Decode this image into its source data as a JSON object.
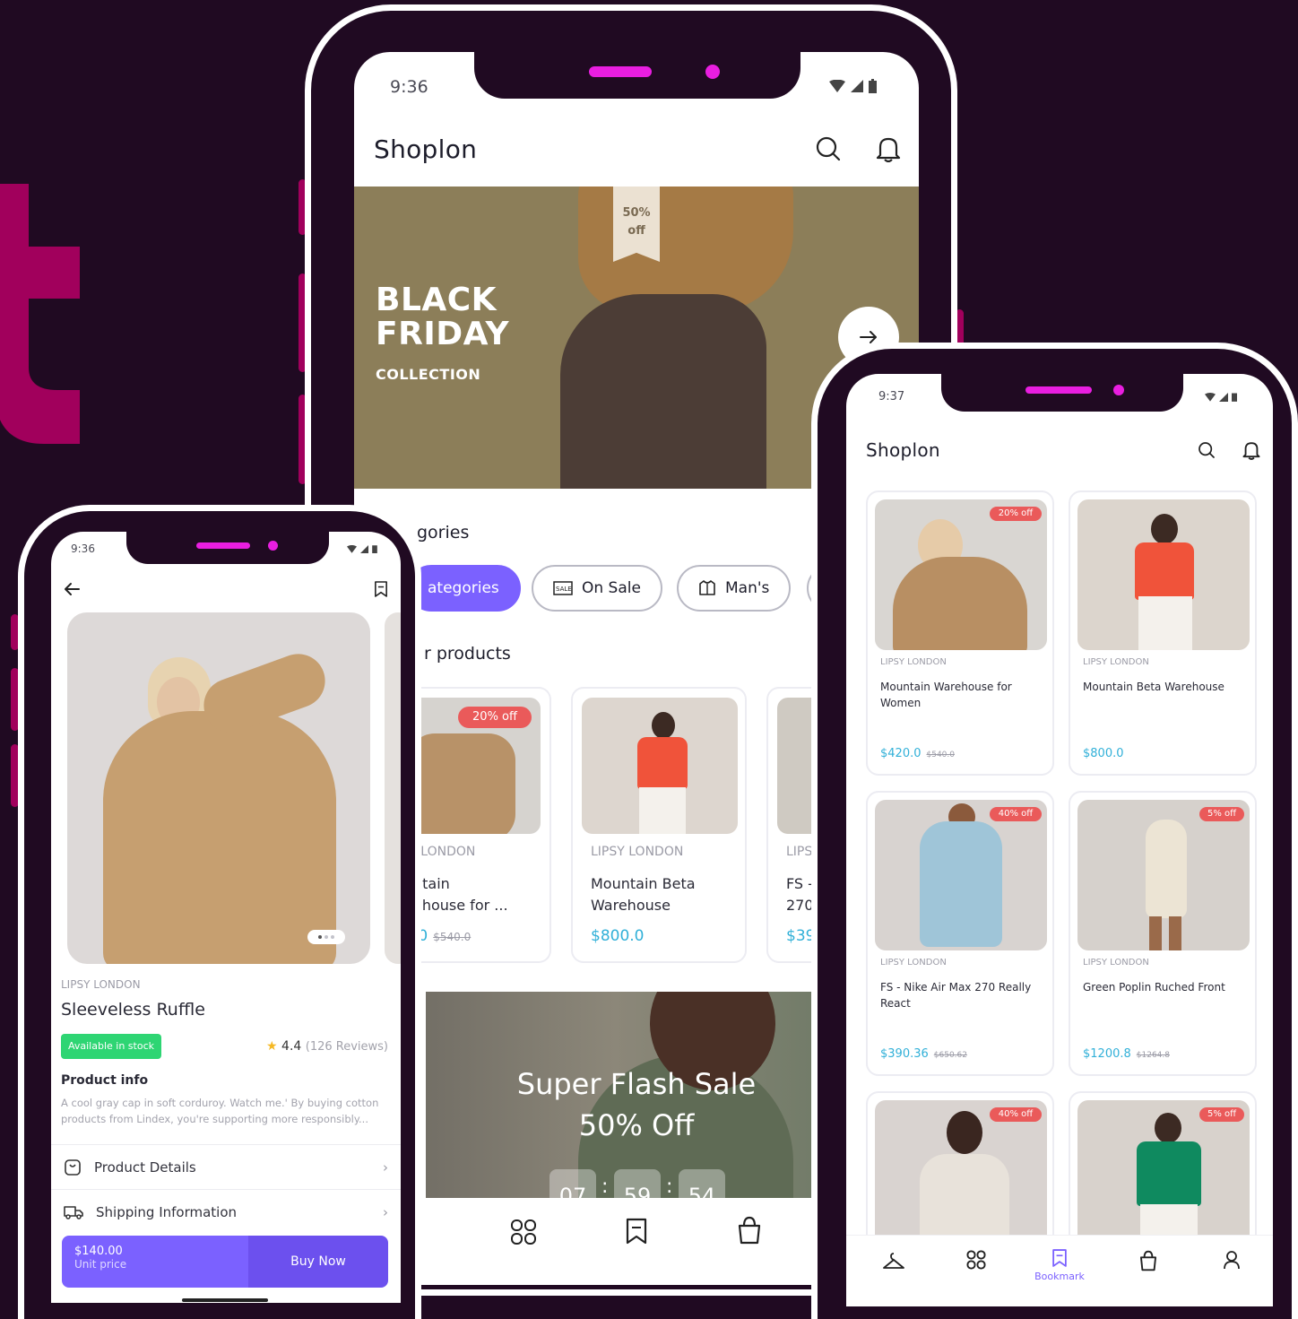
{
  "colors": {
    "accent": "#7b61ff",
    "price": "#31b0d8",
    "badge": "#ea5a5a",
    "stock": "#2ed573",
    "background": "#200a22",
    "notch_accent": "#e91ee0"
  },
  "phone_main": {
    "time": "9:36",
    "app_title": "Shoplon",
    "icons": {
      "search": "search-icon",
      "bell": "bell-icon",
      "arrow": "arrow-right-icon"
    },
    "banner": {
      "tag_line1": "50%",
      "tag_line2": "off",
      "title_line1": "BLACK",
      "title_line2": "FRIDAY",
      "subtitle": "COLLECTION"
    },
    "categories_heading": "gories",
    "chips": [
      {
        "label": "ategories",
        "icon": ""
      },
      {
        "label": "On Sale",
        "icon": "sale-tag-icon"
      },
      {
        "label": "Man's",
        "icon": "shirt-icon"
      }
    ],
    "popular_heading": "r products",
    "products": [
      {
        "brand": "' LONDON",
        "title_line1": "ntain",
        "title_line2": "ehouse for ...",
        "price": ".0",
        "old_price": "$540.0",
        "badge": "20% off"
      },
      {
        "brand": "LIPSY LONDON",
        "title_line1": "Mountain Beta",
        "title_line2": "Warehouse",
        "price": "$800.0",
        "old_price": "",
        "badge": ""
      },
      {
        "brand": "LIPSY",
        "title_line1": "FS -",
        "title_line2": "270",
        "price": "$39",
        "old_price": "",
        "badge": ""
      }
    ],
    "flash": {
      "line1": "Super Flash Sale",
      "line2": "50% Off",
      "timer": [
        "07",
        "59",
        "54"
      ],
      "sep": ":"
    }
  },
  "phone_detail": {
    "time": "9:36",
    "brand": "LIPSY LONDON",
    "title": "Sleeveless Ruffle",
    "stock": "Available in stock",
    "rating": "4.4",
    "reviews": "(126 Reviews)",
    "info_heading": "Product info",
    "info_text": "A cool gray cap in soft corduroy. Watch me.' By buying cotton products from Lindex, you're supporting more responsibly...",
    "rows": [
      {
        "label": "Product Details",
        "icon": "product-icon"
      },
      {
        "label": "Shipping Information",
        "icon": "truck-icon"
      }
    ],
    "price": "$140.00",
    "price_caption": "Unit price",
    "buy_label": "Buy Now"
  },
  "phone_grid": {
    "time": "9:37",
    "app_title": "Shoplon",
    "products": [
      {
        "brand": "LIPSY LONDON",
        "title": "Mountain Warehouse for Women",
        "price": "$420.0",
        "old_price": "$540.0",
        "badge": "20% off"
      },
      {
        "brand": "LIPSY LONDON",
        "title": "Mountain Beta Warehouse",
        "price": "$800.0",
        "old_price": "",
        "badge": ""
      },
      {
        "brand": "LIPSY LONDON",
        "title": "FS - Nike Air Max 270 Really React",
        "price": "$390.36",
        "old_price": "$650.62",
        "badge": "40% off"
      },
      {
        "brand": "LIPSY LONDON",
        "title": "Green Poplin Ruched Front",
        "price": "$1200.8",
        "old_price": "$1264.8",
        "badge": "5% off"
      },
      {
        "brand": "",
        "title": "",
        "price": "",
        "old_price": "",
        "badge": "40% off"
      },
      {
        "brand": "",
        "title": "",
        "price": "",
        "old_price": "",
        "badge": "5% off"
      }
    ],
    "nav": {
      "bookmark_label": "Bookmark"
    }
  }
}
